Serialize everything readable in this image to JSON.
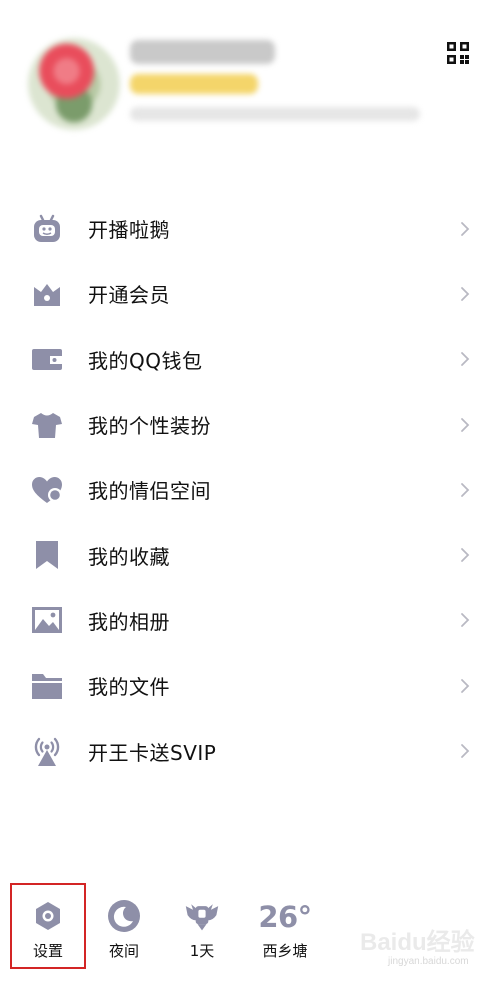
{
  "menu": {
    "items": [
      {
        "label": "开播啦鹅",
        "icon": "penguin-tv-icon"
      },
      {
        "label": "开通会员",
        "icon": "crown-icon"
      },
      {
        "label": "我的QQ钱包",
        "icon": "wallet-icon"
      },
      {
        "label": "我的个性装扮",
        "icon": "tshirt-icon"
      },
      {
        "label": "我的情侣空间",
        "icon": "heart-icon"
      },
      {
        "label": "我的收藏",
        "icon": "bookmark-icon"
      },
      {
        "label": "我的相册",
        "icon": "photo-icon"
      },
      {
        "label": "我的文件",
        "icon": "folder-icon"
      },
      {
        "label": "开王卡送SVIP",
        "icon": "signal-tower-icon"
      }
    ]
  },
  "bottom_bar": {
    "settings_label": "设置",
    "night_label": "夜间",
    "streak_label": "1天",
    "temperature": "26°",
    "location": "西乡塘"
  },
  "watermark": {
    "brand": "Baidu经验",
    "url": "jingyan.baidu.com"
  },
  "colors": {
    "icon": "#8e8fa8",
    "chevron": "#b9b9c3",
    "highlight": "#d32525",
    "vip_gold": "#f4d56a"
  }
}
